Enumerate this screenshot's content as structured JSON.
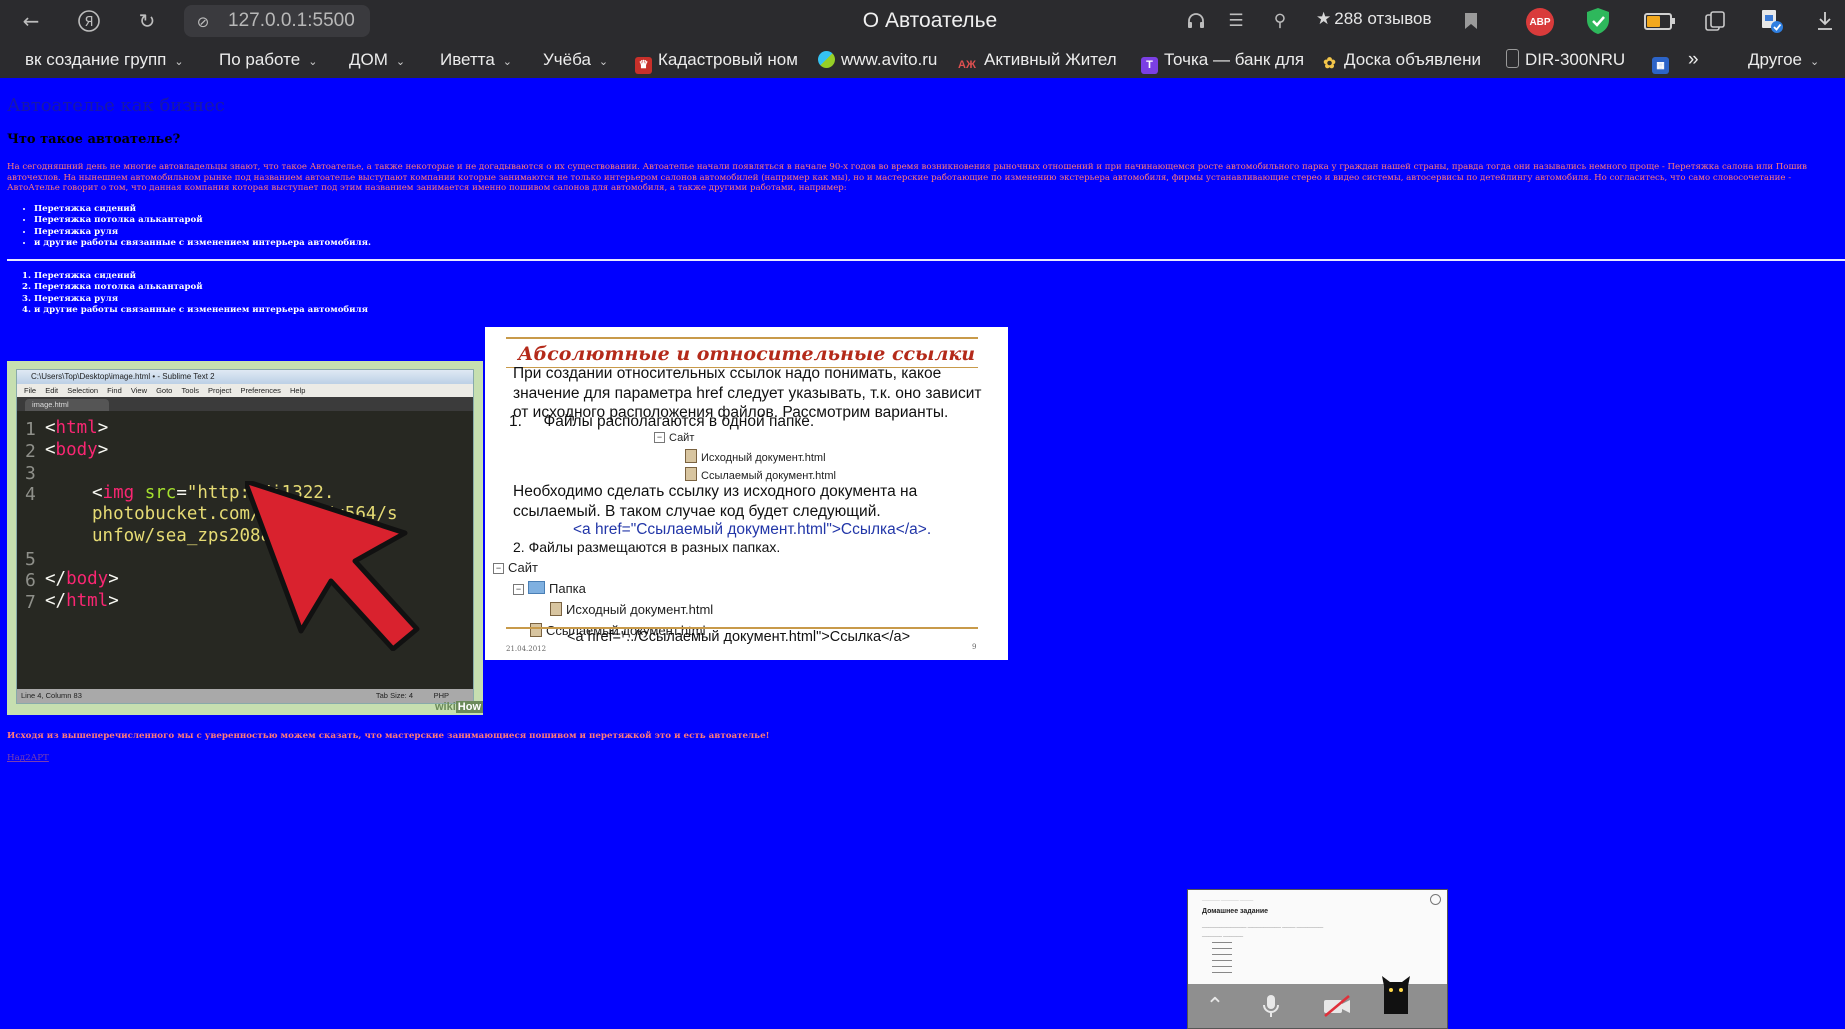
{
  "browser": {
    "url": "127.0.0.1:5500",
    "page_title": "О Автоателье",
    "reviews": "288 отзывов",
    "adblock_label": "ABP",
    "battery_level": 0.6,
    "bookmarks": [
      {
        "label": "вк создание групп",
        "folder": true
      },
      {
        "label": "По работе",
        "folder": true
      },
      {
        "label": "ДОМ",
        "folder": true
      },
      {
        "label": "Иветта",
        "folder": true
      },
      {
        "label": "Учёба",
        "folder": true
      },
      {
        "label": "Кадастровый ном",
        "folder": false,
        "favicon": "emblem-icon"
      },
      {
        "label": "www.avito.ru",
        "folder": false,
        "favicon": "avito-icon"
      },
      {
        "label": "Активный Жител",
        "folder": false,
        "favicon": "aj-icon",
        "favicon_text": "АЖ"
      },
      {
        "label": "Точка — банк для",
        "folder": false,
        "favicon": "tochka-icon",
        "favicon_text": "Т"
      },
      {
        "label": "Доска объявлени",
        "folder": false,
        "favicon": "flower-icon"
      },
      {
        "label": "DIR-300NRU",
        "folder": false,
        "favicon": "doc-icon"
      }
    ],
    "more_label": "Другое"
  },
  "page": {
    "heading": "Автоателье как бизнес",
    "subheading": "Что такое автоателье?",
    "paragraph": "На сегодняшний день не многие автовладельцы знают, что такое Автоателье, а также некоторые и не догадываются о их существовании. Автоателье начали появляться в начале 90-х годов во время возникновения рыночных отношений и при начинающемся росте автомобильного парка у граждан нашей страны, правда тогда они назывались немного проще - Перетяжка салона или Пошив авточехлов. На нынешнем автомобильном рынке под названием автоателье выступают компании которые занимаются не только интерьером салонов автомобилей (например как мы), но и мастерские работающие по изменению экстерьера автомобиля, фирмы устанавливающие стерео и видео системы, автосервисы по детейлингу автомобиля. Но согласитесь, что само словосочетание - АвтоАтелье говорит о том, что данная компания которая выступает под этим названием занимается именно пошивом салонов для автомобиля, а также другими работами, например:",
    "unordered_list": [
      "Перетяжка сидений",
      "Перетяжка потолка алькантарой",
      "Перетяжка руля",
      "и другие работы связанные с изменением интерьера автомобиля."
    ],
    "ordered_list": [
      "Перетяжка сидений",
      "Перетяжка потолка алькантарой",
      "Перетяжка руля",
      "и другие работы связанные с изменением интерьера автомобиля"
    ],
    "conclusion": "Исходя из вышеперечисленного мы с уверенностью можем сказать, что мастерские занимающиеся пошивом и перетяжкой это и есть автоателье!",
    "link_text": "Над2АРТ"
  },
  "sublime_image": {
    "window_title": "C:\\Users\\Top\\Desktop\\image.html • - Sublime Text 2",
    "menu": [
      "File",
      "Edit",
      "Selection",
      "Find",
      "View",
      "Goto",
      "Tools",
      "Project",
      "Preferences",
      "Help"
    ],
    "tab": "image.html",
    "line_numbers": [
      "1",
      "2",
      "3",
      "4",
      "5",
      "6",
      "7"
    ],
    "code": {
      "l1_tag": "html",
      "l2_tag": "body",
      "l4_tag": "img",
      "l4_attr": "src",
      "l4_value_1": "\"http://i1322.",
      "l4_value_2": "photobucket.com/albums/u564/s",
      "l4_value_3": "unfow/sea_zps208895dc.jpg\"",
      "l6_tag": "body",
      "l7_tag": "html"
    },
    "status_left": "Line 4, Column 83",
    "status_right": "Tab Size: 4",
    "status_lang": "PHP",
    "watermark_1": "wiki",
    "watermark_2": "How"
  },
  "slide_image": {
    "title": "Абсолютные и относительные ссылки",
    "intro": "При создании относительных ссылок надо понимать, какое значение для параметра href следует указывать, т.к. оно зависит от исходного расположения файлов. Рассмотрим варианты.",
    "item1": "1.     Файлы располагаются в одной папке.",
    "tree1_root": "Сайт",
    "tree1_a": "Исходный документ.html",
    "tree1_b": "Ссылаемый документ.html",
    "text2": "Необходимо сделать ссылку из исходного документа на ссылаемый. В таком случае код будет следующий.",
    "code1": "<a href=\"Ссылаемый документ.html\">Ссылка</a>.",
    "item2": "2. Файлы размещаются в разных папках.",
    "tree2_root": "Сайт",
    "tree2_folder": "Папка",
    "tree2_a": "Исходный документ.html",
    "tree2_b": "Ссылаемый документ.html",
    "code2": "<a href=\"../Ссылаемый документ.html\">Ссылка</a>",
    "date": "21.04.2012",
    "page": "9"
  },
  "video_widget": {
    "doc_header": "Домашнее задание",
    "controls": [
      "chevron-up-icon",
      "microphone-icon",
      "camera-off-icon"
    ]
  }
}
